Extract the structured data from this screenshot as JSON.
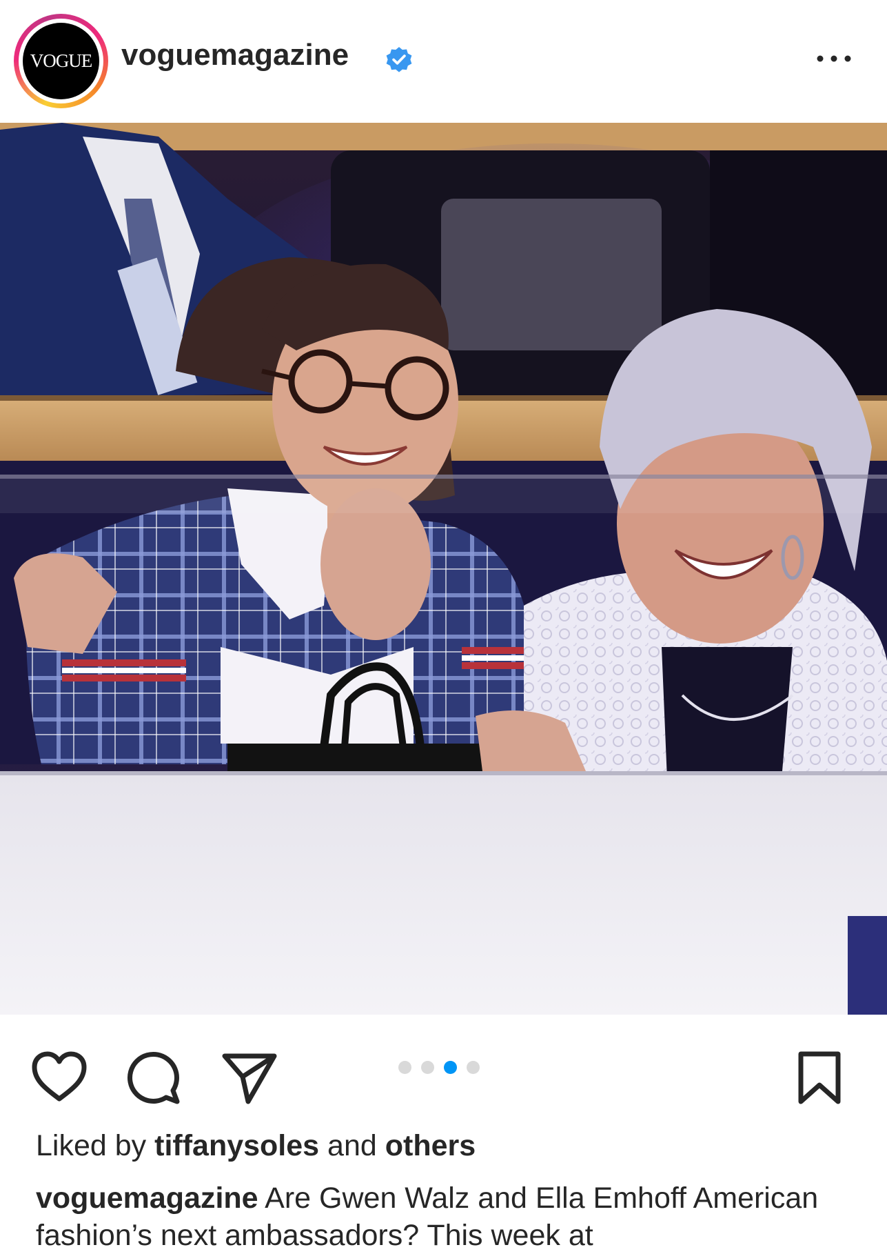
{
  "post": {
    "account": {
      "avatar_text": "VOGUE",
      "username": "voguemagazine",
      "verified_icon": "verified-badge-icon",
      "verified_color": "#3897f0"
    },
    "more_icon": "more-options-icon",
    "photo": {
      "icon": "photo"
    },
    "actions": {
      "like_icon": "heart-icon",
      "comment_icon": "comment-icon",
      "share_icon": "share-icon",
      "save_icon": "bookmark-icon"
    },
    "carousel": {
      "total": 4,
      "active_index": 2,
      "active_color": "#0095f6"
    },
    "likes": {
      "prefix": "Liked by",
      "user": "tiffanysoles",
      "middle": "and",
      "others": "others"
    },
    "caption": {
      "author": "voguemagazine",
      "text": "Are Gwen Walz and Ella Emhoff American fashion’s next ambassadors? This week at"
    }
  }
}
